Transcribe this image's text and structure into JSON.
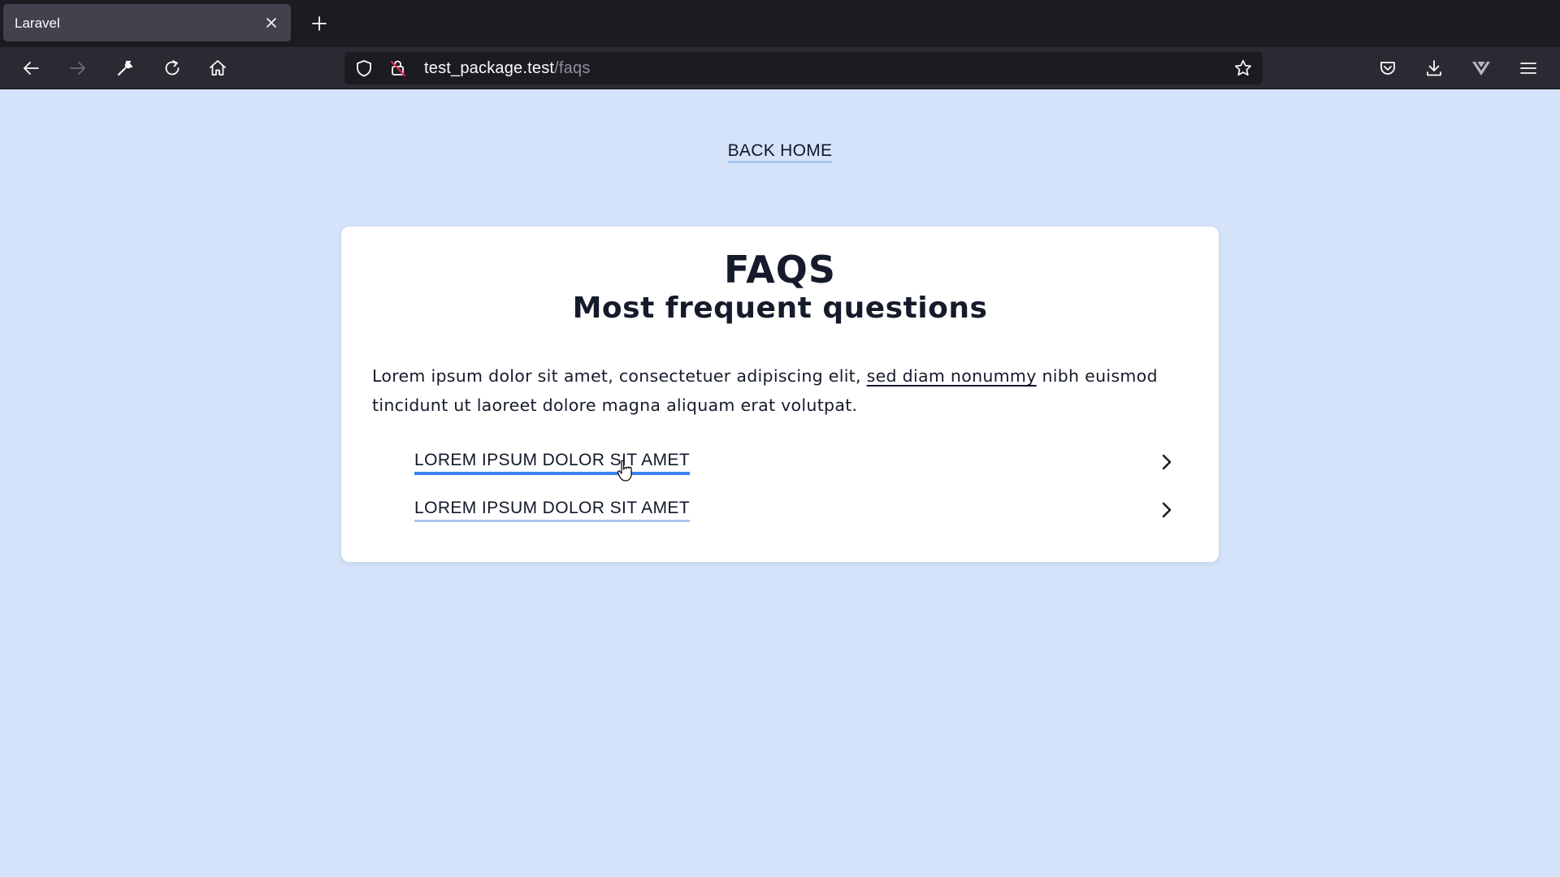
{
  "browser": {
    "tab": {
      "title": "Laravel"
    },
    "url": {
      "host": "test_package.test",
      "path": "/faqs"
    },
    "icons": {
      "tab_close": "close-icon",
      "new_tab": "plus-icon",
      "back": "arrow-left-icon",
      "forward": "arrow-right-icon",
      "tools": "wrench-icon",
      "reload": "reload-icon",
      "home": "home-icon",
      "shield": "shield-icon",
      "lock": "lock-warning-icon",
      "bookmark": "star-icon",
      "pocket": "pocket-icon",
      "downloads": "download-icon",
      "extension": "extension-icon",
      "menu": "hamburger-menu-icon"
    }
  },
  "page": {
    "back_home": "BACK HOME",
    "title": "FAQS",
    "subtitle": "Most frequent questions",
    "intro": {
      "text_before": "Lorem ipsum dolor sit amet, consectetuer adipiscing elit, ",
      "link": "sed diam nonummy",
      "text_after": " nibh euismod tincidunt ut laoreet dolore magna aliquam erat volutpat."
    },
    "faqs": [
      {
        "question": "LOREM IPSUM DOLOR SIT AMET",
        "state": "hovered"
      },
      {
        "question": "LOREM IPSUM DOLOR SIT AMET",
        "state": "default"
      }
    ]
  },
  "colors": {
    "page_background": "#d4e3f9",
    "card_background": "#ffffff",
    "text": "#151b2b",
    "link_underline": "#a9c6f1",
    "active_underline": "#3b82f6",
    "chrome_dark": "#1c1b22",
    "chrome_toolbar": "#2b2a33"
  }
}
